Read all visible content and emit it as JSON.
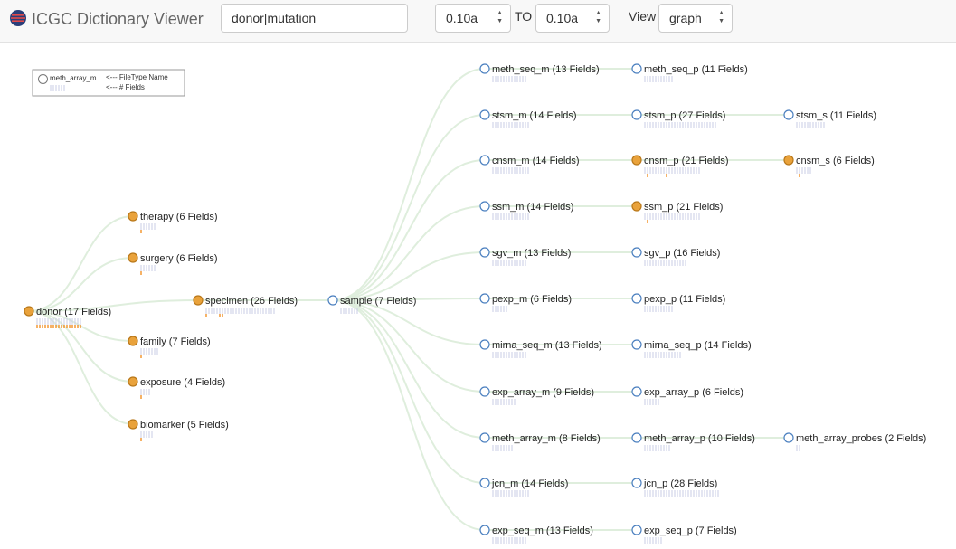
{
  "app": {
    "title": "ICGC Dictionary Viewer"
  },
  "toolbar": {
    "search_value": "donor|mutation",
    "from_version": "0.10a",
    "to_label": "TO",
    "to_version": "0.10a",
    "view_label": "View",
    "view_value": "graph"
  },
  "legend": {
    "node_name": "meth_array_m",
    "filetype_note": "<--- FileType Name",
    "fields_note": "<--- # Fields"
  },
  "colors": {
    "filled": "#e9a23b",
    "empty_stroke": "#4a7fbf",
    "link": "#dfeedd",
    "tick": "#c9cde6",
    "tick_changed": "#f07f00"
  },
  "nodes": [
    {
      "id": "donor",
      "label": "donor (17 Fields)",
      "fields": 17,
      "filled": true,
      "changed": [
        0,
        1,
        2,
        3,
        4,
        5,
        6,
        7,
        8,
        9,
        10,
        11,
        12,
        13,
        14,
        15,
        16
      ]
    },
    {
      "id": "therapy",
      "label": "therapy (6 Fields)",
      "fields": 6,
      "filled": true,
      "changed": [
        0
      ]
    },
    {
      "id": "surgery",
      "label": "surgery (6 Fields)",
      "fields": 6,
      "filled": true,
      "changed": [
        0
      ]
    },
    {
      "id": "specimen",
      "label": "specimen (26 Fields)",
      "fields": 26,
      "filled": true,
      "changed": [
        0,
        5,
        6
      ]
    },
    {
      "id": "family",
      "label": "family (7 Fields)",
      "fields": 7,
      "filled": true,
      "changed": [
        0
      ]
    },
    {
      "id": "exposure",
      "label": "exposure (4 Fields)",
      "fields": 4,
      "filled": true,
      "changed": [
        0
      ]
    },
    {
      "id": "biomarker",
      "label": "biomarker (5 Fields)",
      "fields": 5,
      "filled": true,
      "changed": [
        0
      ]
    },
    {
      "id": "sample",
      "label": "sample (7 Fields)",
      "fields": 7,
      "filled": false,
      "changed": []
    },
    {
      "id": "meth_seq_m",
      "label": "meth_seq_m (13 Fields)",
      "fields": 13,
      "filled": false,
      "changed": []
    },
    {
      "id": "meth_seq_p",
      "label": "meth_seq_p (11 Fields)",
      "fields": 11,
      "filled": false,
      "changed": []
    },
    {
      "id": "stsm_m",
      "label": "stsm_m (14 Fields)",
      "fields": 14,
      "filled": false,
      "changed": []
    },
    {
      "id": "stsm_p",
      "label": "stsm_p (27 Fields)",
      "fields": 27,
      "filled": false,
      "changed": []
    },
    {
      "id": "stsm_s",
      "label": "stsm_s (11 Fields)",
      "fields": 11,
      "filled": false,
      "changed": []
    },
    {
      "id": "cnsm_m",
      "label": "cnsm_m (14 Fields)",
      "fields": 14,
      "filled": false,
      "changed": []
    },
    {
      "id": "cnsm_p",
      "label": "cnsm_p (21 Fields)",
      "fields": 21,
      "filled": true,
      "changed": [
        1,
        8
      ]
    },
    {
      "id": "cnsm_s",
      "label": "cnsm_s (6 Fields)",
      "fields": 6,
      "filled": true,
      "changed": [
        1
      ]
    },
    {
      "id": "ssm_m",
      "label": "ssm_m (14 Fields)",
      "fields": 14,
      "filled": false,
      "changed": []
    },
    {
      "id": "ssm_p",
      "label": "ssm_p (21 Fields)",
      "fields": 21,
      "filled": true,
      "changed": [
        1
      ]
    },
    {
      "id": "sgv_m",
      "label": "sgv_m (13 Fields)",
      "fields": 13,
      "filled": false,
      "changed": []
    },
    {
      "id": "sgv_p",
      "label": "sgv_p (16 Fields)",
      "fields": 16,
      "filled": false,
      "changed": []
    },
    {
      "id": "pexp_m",
      "label": "pexp_m (6 Fields)",
      "fields": 6,
      "filled": false,
      "changed": []
    },
    {
      "id": "pexp_p",
      "label": "pexp_p (11 Fields)",
      "fields": 11,
      "filled": false,
      "changed": []
    },
    {
      "id": "mirna_seq_m",
      "label": "mirna_seq_m (13 Fields)",
      "fields": 13,
      "filled": false,
      "changed": []
    },
    {
      "id": "mirna_seq_p",
      "label": "mirna_seq_p (14 Fields)",
      "fields": 14,
      "filled": false,
      "changed": []
    },
    {
      "id": "exp_array_m",
      "label": "exp_array_m (9 Fields)",
      "fields": 9,
      "filled": false,
      "changed": []
    },
    {
      "id": "exp_array_p",
      "label": "exp_array_p (6 Fields)",
      "fields": 6,
      "filled": false,
      "changed": []
    },
    {
      "id": "meth_array_m",
      "label": "meth_array_m (8 Fields)",
      "fields": 8,
      "filled": false,
      "changed": []
    },
    {
      "id": "meth_array_p",
      "label": "meth_array_p (10 Fields)",
      "fields": 10,
      "filled": false,
      "changed": []
    },
    {
      "id": "meth_array_probes",
      "label": "meth_array_probes (2 Fields)",
      "fields": 2,
      "filled": false,
      "changed": []
    },
    {
      "id": "jcn_m",
      "label": "jcn_m (14 Fields)",
      "fields": 14,
      "filled": false,
      "changed": []
    },
    {
      "id": "jcn_p",
      "label": "jcn_p (28 Fields)",
      "fields": 28,
      "filled": false,
      "changed": []
    },
    {
      "id": "exp_seq_m",
      "label": "exp_seq_m (13 Fields)",
      "fields": 13,
      "filled": false,
      "changed": []
    },
    {
      "id": "exp_seq_p",
      "label": "exp_seq_p (7 Fields)",
      "fields": 7,
      "filled": false,
      "changed": []
    }
  ],
  "links": [
    [
      "donor",
      "therapy"
    ],
    [
      "donor",
      "surgery"
    ],
    [
      "donor",
      "specimen"
    ],
    [
      "donor",
      "family"
    ],
    [
      "donor",
      "exposure"
    ],
    [
      "donor",
      "biomarker"
    ],
    [
      "specimen",
      "sample"
    ],
    [
      "sample",
      "meth_seq_m"
    ],
    [
      "sample",
      "stsm_m"
    ],
    [
      "sample",
      "cnsm_m"
    ],
    [
      "sample",
      "ssm_m"
    ],
    [
      "sample",
      "sgv_m"
    ],
    [
      "sample",
      "pexp_m"
    ],
    [
      "sample",
      "mirna_seq_m"
    ],
    [
      "sample",
      "exp_array_m"
    ],
    [
      "sample",
      "meth_array_m"
    ],
    [
      "sample",
      "jcn_m"
    ],
    [
      "sample",
      "exp_seq_m"
    ],
    [
      "meth_seq_m",
      "meth_seq_p"
    ],
    [
      "stsm_m",
      "stsm_p"
    ],
    [
      "stsm_p",
      "stsm_s"
    ],
    [
      "cnsm_m",
      "cnsm_p"
    ],
    [
      "cnsm_p",
      "cnsm_s"
    ],
    [
      "ssm_m",
      "ssm_p"
    ],
    [
      "sgv_m",
      "sgv_p"
    ],
    [
      "pexp_m",
      "pexp_p"
    ],
    [
      "mirna_seq_m",
      "mirna_seq_p"
    ],
    [
      "exp_array_m",
      "exp_array_p"
    ],
    [
      "meth_array_m",
      "meth_array_p"
    ],
    [
      "meth_array_p",
      "meth_array_probes"
    ],
    [
      "jcn_m",
      "jcn_p"
    ],
    [
      "exp_seq_m",
      "exp_seq_p"
    ]
  ]
}
